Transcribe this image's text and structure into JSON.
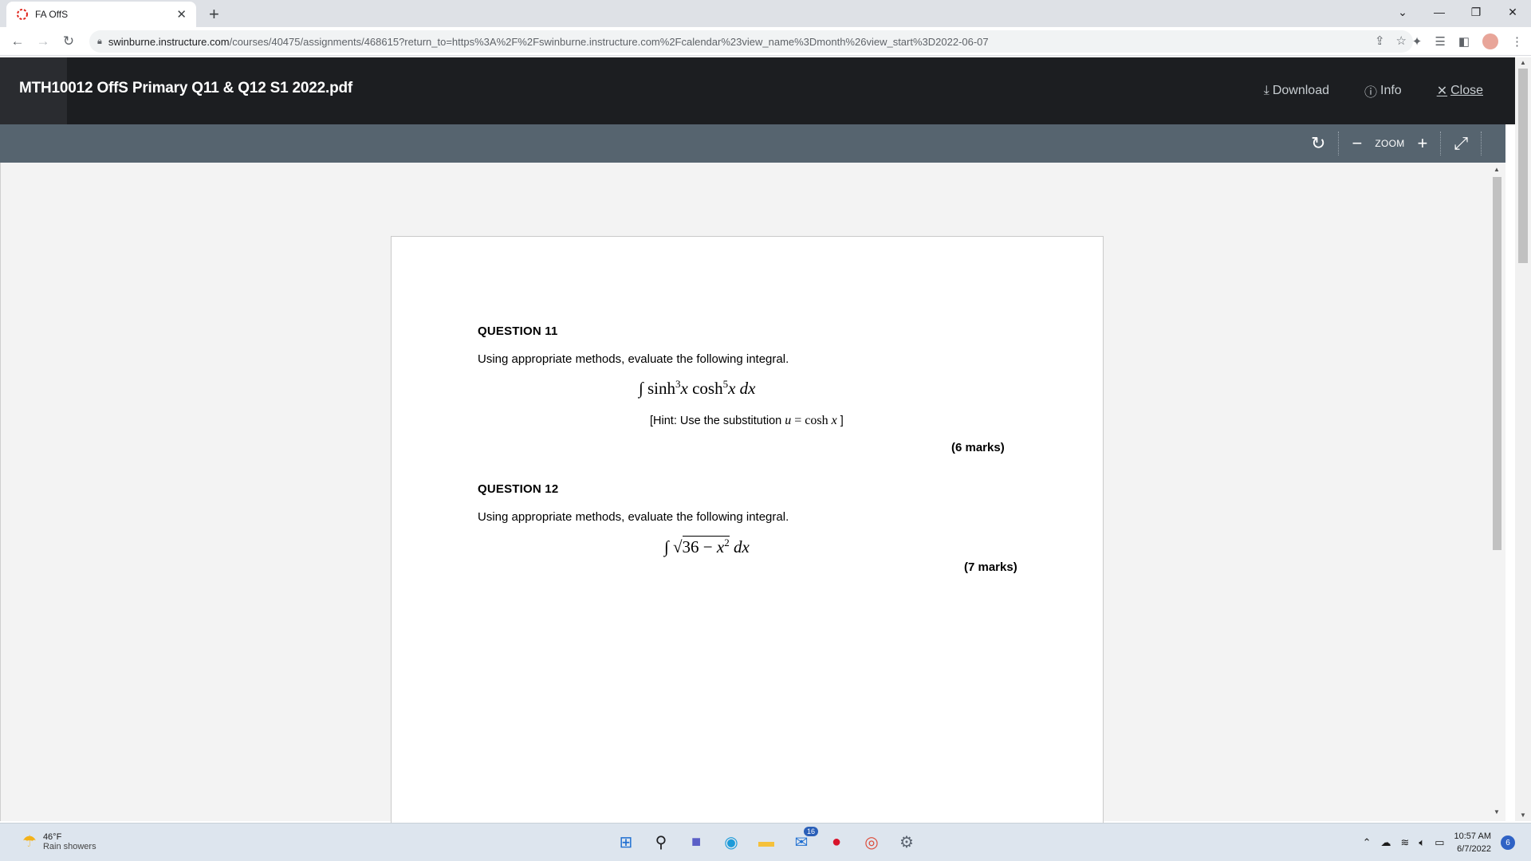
{
  "browser": {
    "tab_title": "FA OffS",
    "new_tab": "+",
    "url_host": "swinburne.instructure.com",
    "url_rest": "/courses/40475/assignments/468615?return_to=https%3A%2F%2Fswinburne.instructure.com%2Fcalendar%23view_name%3Dmonth%26view_start%3D2022-06-07"
  },
  "preview": {
    "file_title": "MTH10012 OffS Primary Q11 & Q12 S1 2022.pdf",
    "download_label": "Download",
    "info_label": "Info",
    "close_label": "Close"
  },
  "viewer": {
    "zoom_label": "ZOOM"
  },
  "document": {
    "q11_heading": "QUESTION 11",
    "q11_text": "Using appropriate methods, evaluate the following integral.",
    "q11_hint_prefix": "[Hint:  Use the substitution ",
    "q11_hint_suffix": " ]",
    "q11_marks": "(6 marks)",
    "q12_heading": "QUESTION 12",
    "q12_text": "Using appropriate methods, evaluate the following integral.",
    "q12_marks": "(7 marks)"
  },
  "taskbar": {
    "weather_temp": "46°F",
    "weather_desc": "Rain showers",
    "mail_badge": "16",
    "time": "10:57 AM",
    "date": "6/7/2022",
    "notification_count": "6"
  }
}
